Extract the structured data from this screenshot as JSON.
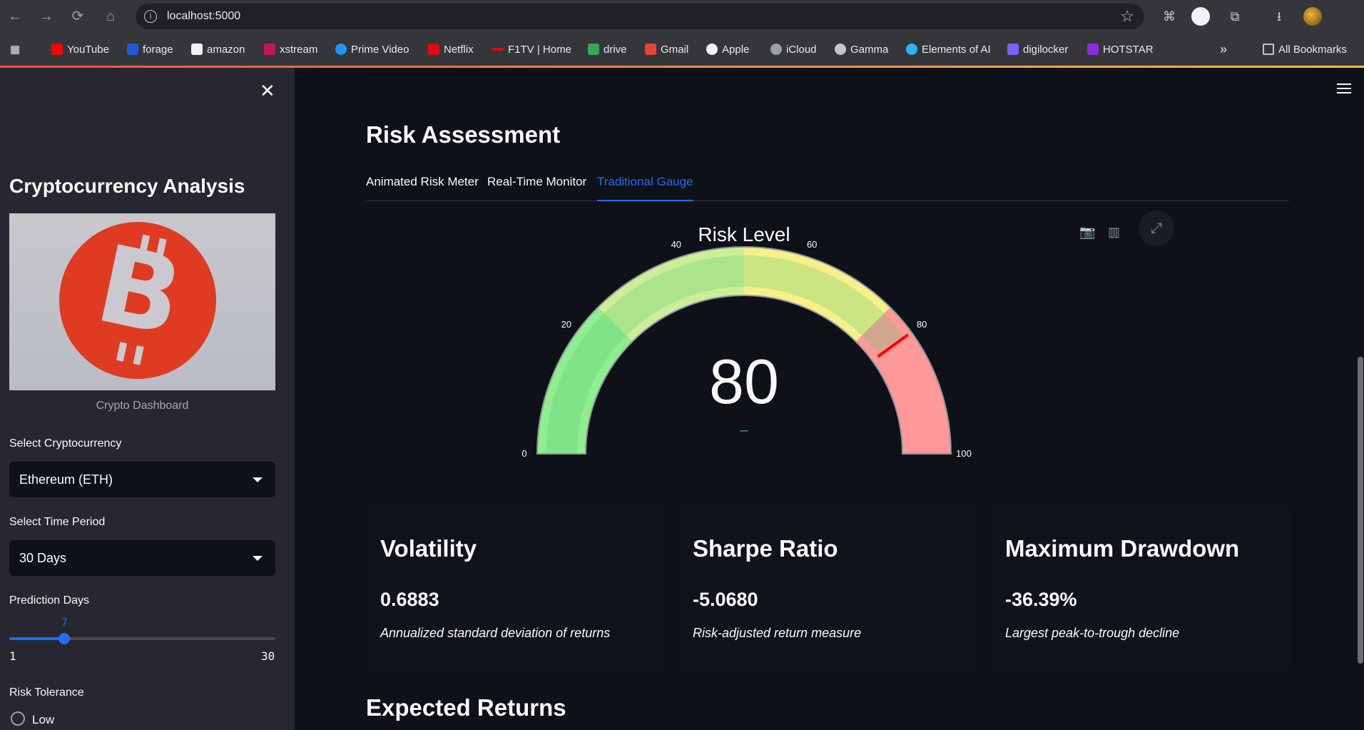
{
  "browser": {
    "url": "localhost:5000",
    "bookmarks": [
      "YouTube",
      "forage",
      "amazon",
      "xstream",
      "Prime Video",
      "Netflix",
      "F1TV | Home",
      "drive",
      "Gmail",
      "Apple",
      "iCloud",
      "Gamma",
      "Elements of AI",
      "digilocker",
      "HOTSTAR"
    ],
    "all_bookmarks_label": "All Bookmarks",
    "overflow_label": "»"
  },
  "sidebar": {
    "title": "Cryptocurrency Analysis",
    "image_caption": "Crypto Dashboard",
    "crypto_label": "Select Cryptocurrency",
    "crypto_value": "Ethereum (ETH)",
    "period_label": "Select Time Period",
    "period_value": "30 Days",
    "prediction_label": "Prediction Days",
    "prediction_value": "7",
    "prediction_min": "1",
    "prediction_max": "30",
    "prediction_fraction": 0.2069,
    "risk_label": "Risk Tolerance",
    "risk_option_low": "Low"
  },
  "main": {
    "title": "Risk Assessment",
    "tabs": [
      "Animated Risk Meter",
      "Real-Time Monitor",
      "Traditional Gauge"
    ],
    "active_tab": 2,
    "section_2_title": "Expected Returns"
  },
  "gauge": {
    "title": "Risk Level",
    "value": "80",
    "delta": "–",
    "min": 0,
    "max": 100,
    "ticks": [
      "0",
      "20",
      "40",
      "60",
      "80",
      "100"
    ],
    "threshold": 80,
    "bands": [
      {
        "from": 0,
        "to": 25,
        "color": "#90ee90"
      },
      {
        "from": 25,
        "to": 50,
        "color": "#ccee99"
      },
      {
        "from": 50,
        "to": 75,
        "color": "#f5f08a"
      },
      {
        "from": 75,
        "to": 100,
        "color": "#ff9999"
      }
    ]
  },
  "cards": [
    {
      "title": "Volatility",
      "value": "0.6883",
      "desc": "Annualized standard deviation of returns"
    },
    {
      "title": "Sharpe Ratio",
      "value": "-5.0680",
      "desc": "Risk-adjusted return measure"
    },
    {
      "title": "Maximum Drawdown",
      "value": "-36.39%",
      "desc": "Largest peak-to-trough decline"
    }
  ]
}
